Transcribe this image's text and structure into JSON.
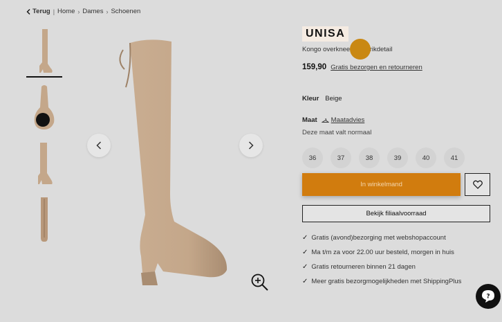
{
  "breadcrumb": {
    "back_label": "Terug",
    "items": [
      "Home",
      "Dames",
      "Schoenen"
    ]
  },
  "product": {
    "brand": "UNISA",
    "title": "Kongo overknee met strikdetail",
    "price": "159,90",
    "price_link": "Gratis bezorgen en retourneren",
    "color_label": "Kleur",
    "color_value": "Beige",
    "size_label": "Maat",
    "size_advice": "Maatadvies",
    "fit_note": "Deze maat valt normaal",
    "sizes": [
      "36",
      "37",
      "38",
      "39",
      "40",
      "41"
    ]
  },
  "actions": {
    "cart_label": "In winkelmand",
    "store_label": "Bekijk filiaalvoorraad"
  },
  "usps": [
    "Gratis (avond)bezorging met webshopaccount",
    "Ma t/m za voor 22.00 uur besteld, morgen in huis",
    "Gratis retourneren binnen 21 dagen",
    "Meer gratis bezorgmogelijkheden met ShippingPlus"
  ],
  "colors": {
    "accent": "#d17c0e",
    "boot": "#c4a78a",
    "brand_bg": "#f5ebe2"
  }
}
